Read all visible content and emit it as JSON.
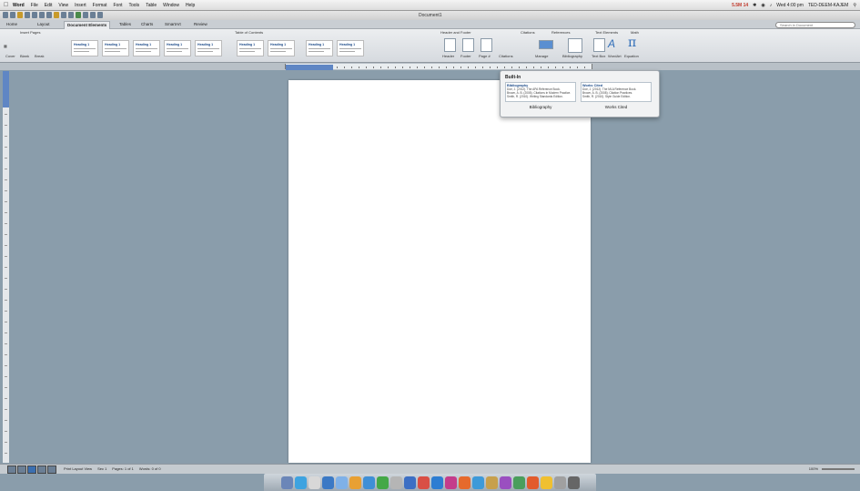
{
  "menubar": {
    "apple": "",
    "items": [
      "Word",
      "File",
      "Edit",
      "View",
      "Insert",
      "Format",
      "Font",
      "Tools",
      "Table",
      "Window",
      "Help"
    ],
    "status_time": "Wed 4:00 pm",
    "status_user": "TED-DEEM-KAJEM",
    "status_red": "5.5M 14"
  },
  "window": {
    "document_title": "Document1"
  },
  "search": {
    "placeholder": "Search in Document"
  },
  "tabs": [
    "Home",
    "Layout",
    "Document Elements",
    "Tables",
    "Charts",
    "SmartArt",
    "Review"
  ],
  "ribbon": {
    "groups": {
      "cover_pages": "Insert Pages",
      "table_of_contents": "Table of Contents",
      "header_footer": "Header and Footer",
      "citations": "Citations",
      "references": "References",
      "text_elements": "Text Elements",
      "math": "Math"
    },
    "page_buttons": [
      "Cover",
      "Blank",
      "Break"
    ],
    "toc_styles": [
      "Heading 1",
      "Heading 1",
      "Heading 1",
      "Heading 1",
      "Heading 1",
      "Heading 1",
      "Heading 1",
      "Heading 1",
      "Heading 1"
    ],
    "hf_buttons": [
      "Header",
      "Footer",
      "Page #"
    ],
    "citation_buttons": [
      "Citations",
      "Manage"
    ],
    "reference_buttons": [
      "Bibliography"
    ],
    "text_buttons": [
      "Text Box",
      "WordArt",
      "Equation"
    ],
    "math_symbol": "π"
  },
  "popup": {
    "title": "Built-In",
    "option1": {
      "heading": "Bibliography",
      "lines": [
        "Doe, J. (2012). The APA Reference Book.",
        "Brown, A. B. (2008). Citations in Modern Practice.",
        "Smith, R. (2010). Writing Standards Edition."
      ]
    },
    "option2": {
      "heading": "Works Cited",
      "lines": [
        "Doe, J. (2012). The MLA Reference Book.",
        "Brown, A. B. (2008). Citation Practices.",
        "Smith, R. (2010). Style Guide Edition."
      ]
    },
    "label1": "Bibliography",
    "label2": "Works Cited"
  },
  "statusbar": {
    "view_label": "Print Layout View",
    "sec": "Sec 1",
    "pages": "Pages: 1 of 1",
    "words": "Words: 0 of 0",
    "zoom": "100%"
  },
  "dock": {
    "colors": [
      "#6b86b8",
      "#3ea3e0",
      "#d8d8d8",
      "#3b79c5",
      "#7fb1e8",
      "#e8a033",
      "#3f8fd6",
      "#44a847",
      "#b5b5b5",
      "#3c6fc4",
      "#d94f45",
      "#2d7dd2",
      "#c43c8b",
      "#e66a2c",
      "#3d9ad9",
      "#c7a04c",
      "#9a4fc0",
      "#4a9e5c",
      "#e25b2c",
      "#f0c030",
      "#a0a0a0",
      "#666"
    ]
  }
}
